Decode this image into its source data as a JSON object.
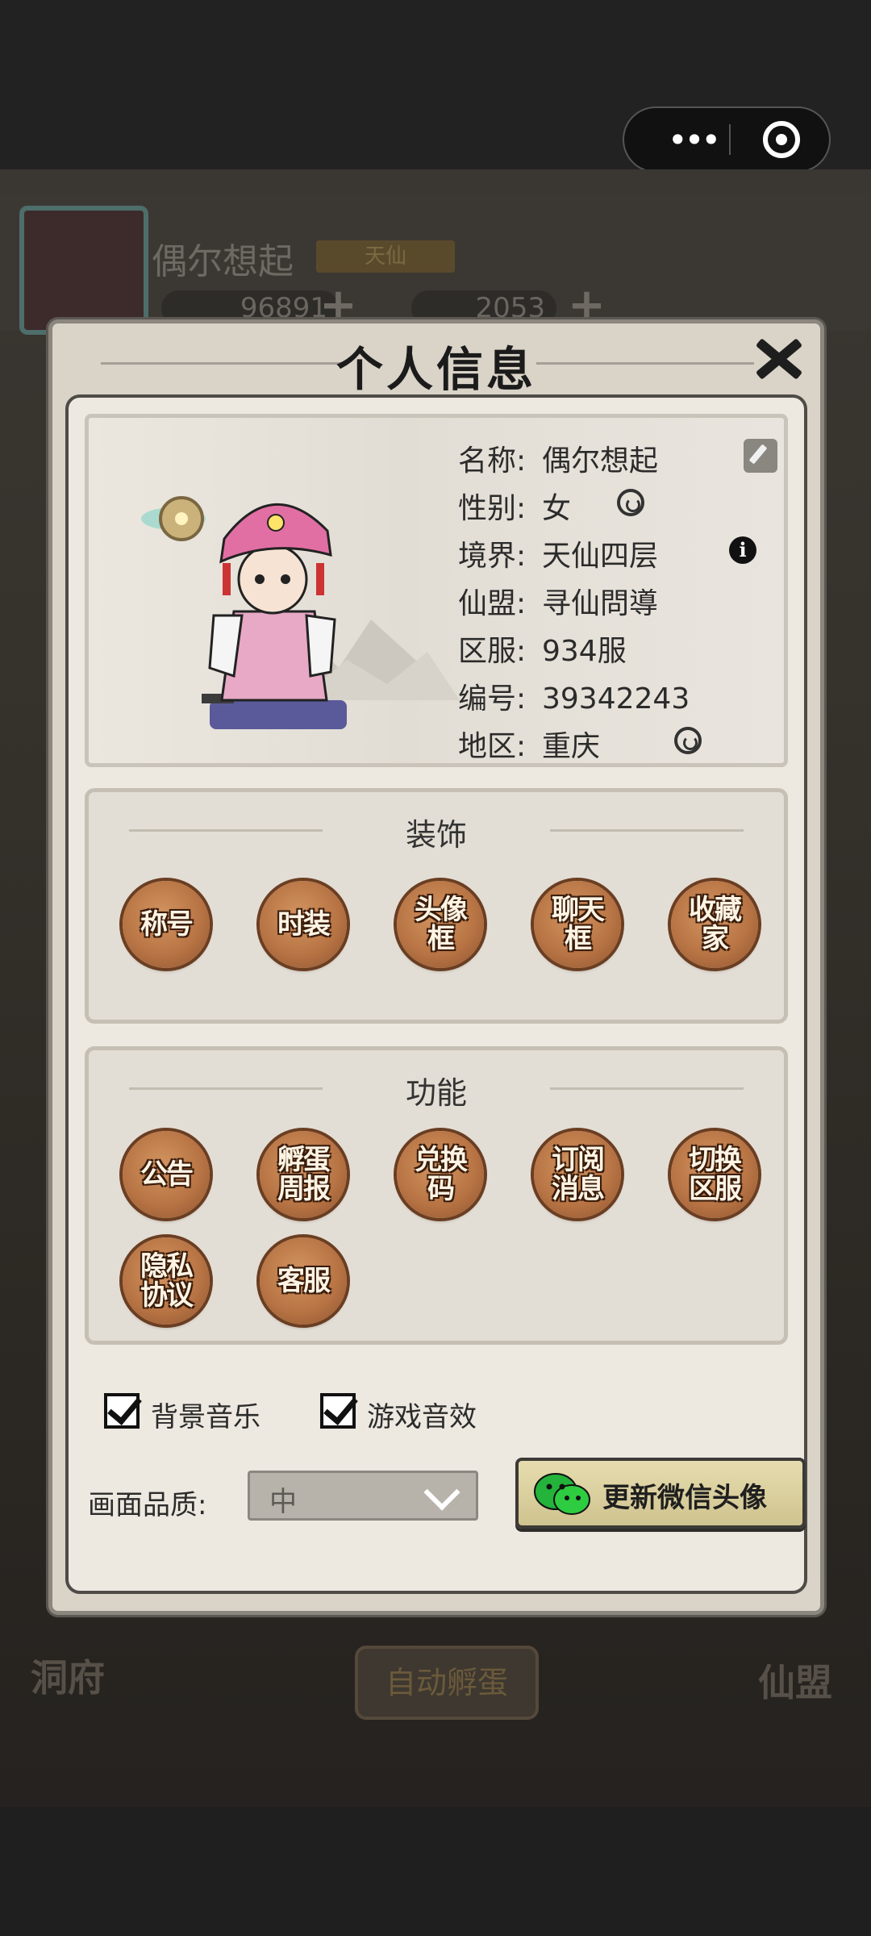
{
  "topbar": {
    "more_icon": "ellipsis-icon",
    "target_icon": "target-icon"
  },
  "background": {
    "player_name": "偶尔想起",
    "rank_label": "天仙",
    "currency1": "96891",
    "currency2": "2053",
    "auto_hatch_button": "自动孵蛋",
    "left_nav": "洞府",
    "right_nav": "仙盟"
  },
  "modal": {
    "title": "个人信息",
    "close_icon": "close-icon",
    "profile": {
      "rows": [
        {
          "key": "名称:",
          "value": "偶尔想起"
        },
        {
          "key": "性别:",
          "value": "女"
        },
        {
          "key": "境界:",
          "value": "天仙四层"
        },
        {
          "key": "仙盟:",
          "value": "寻仙問導"
        },
        {
          "key": "区服:",
          "value": "934服"
        },
        {
          "key": "编号:",
          "value": "39342243"
        },
        {
          "key": "地区:",
          "value": "重庆"
        }
      ]
    },
    "decoration": {
      "title": "装饰",
      "buttons": [
        "称号",
        "时装",
        "头像框",
        "聊天框",
        "收藏家"
      ]
    },
    "functions": {
      "title": "功能",
      "buttons": [
        "公告",
        "孵蛋周报",
        "兑换码",
        "订阅消息",
        "切换区服",
        "隐私协议",
        "客服"
      ]
    },
    "settings": {
      "bgm_label": "背景音乐",
      "sfx_label": "游戏音效",
      "quality_label": "画面品质:",
      "quality_value": "中",
      "update_avatar_button": "更新微信头像"
    }
  }
}
